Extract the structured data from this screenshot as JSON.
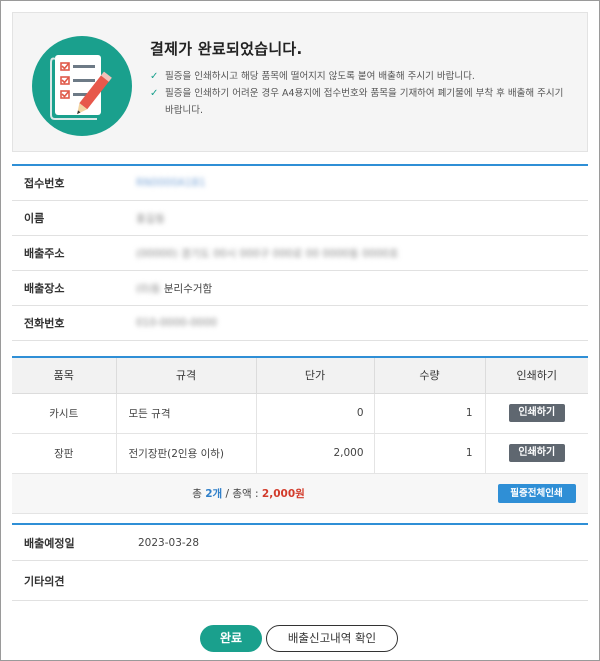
{
  "completion": {
    "title": "결제가 완료되었습니다.",
    "notes": [
      "필증을 인쇄하시고 해당 품목에 떨어지지 않도록 붙여 배출해 주시기 바랍니다.",
      "필증을 인쇄하기 어려운 경우 A4용지에 접수번호와 품목을 기재하여 폐기물에 부착 후 배출해 주시기 바랍니다."
    ],
    "icon": "checklist-pencil-icon",
    "accent_color": "#1aa08d"
  },
  "info": {
    "receipt_no_label": "접수번호",
    "receipt_no_value": "RN0000A1B1",
    "name_label": "이름",
    "name_value": "홍길동",
    "address_label": "배출주소",
    "address_value": "(00000) 경기도 00시 000구 000로 00 0000동 0000호",
    "place_label": "배출장소",
    "place_prefix": "(0)동",
    "place_value": "분리수거함",
    "phone_label": "전화번호",
    "phone_value": "010-0000-0000"
  },
  "items_table": {
    "headers": [
      "품목",
      "규격",
      "단가",
      "수량",
      "인쇄하기"
    ],
    "rows": [
      {
        "name": "카시트",
        "spec": "모든 규격",
        "price": "0",
        "qty": "1",
        "print": "인쇄하기"
      },
      {
        "name": "장판",
        "spec": "전기장판(2인용 이하)",
        "price": "2,000",
        "qty": "1",
        "print": "인쇄하기"
      }
    ],
    "total": {
      "prefix": "총 ",
      "count": "2개",
      "middle": " / 총액 : ",
      "amount": "2,000원"
    },
    "print_all": "필증전체인쇄"
  },
  "schedule": {
    "date_label": "배출예정일",
    "date_value": "2023-03-28",
    "memo_label": "기타의견",
    "memo_value": ""
  },
  "buttons": {
    "done": "완료",
    "history": "배출신고내역 확인"
  },
  "colors": {
    "primary_blue": "#2f8fd6",
    "teal": "#1aa08d",
    "amount_red": "#d23b2b"
  }
}
